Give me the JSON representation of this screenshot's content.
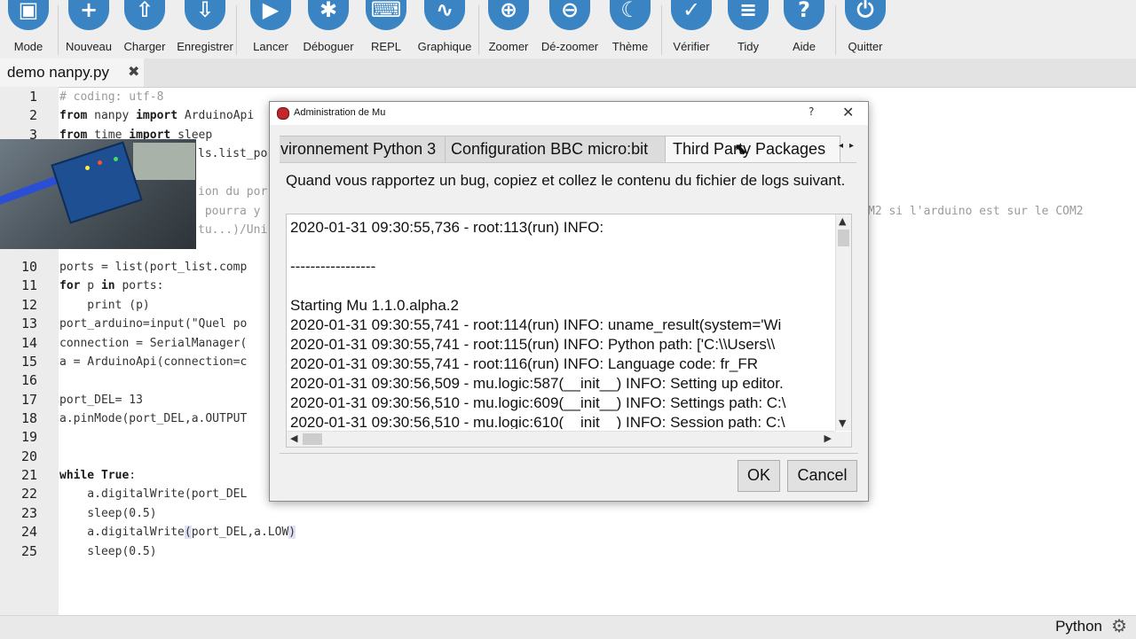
{
  "toolbar": {
    "buttons": [
      {
        "label": "Mode",
        "icon": "mode-icon",
        "glyph": "▣"
      },
      {
        "label": "Nouveau",
        "icon": "plus-icon",
        "glyph": "+"
      },
      {
        "label": "Charger",
        "icon": "upload-icon",
        "glyph": "⇧"
      },
      {
        "label": "Enregistrer",
        "icon": "download-icon",
        "glyph": "⇩"
      },
      {
        "label": "Lancer",
        "icon": "play-icon",
        "glyph": "▶"
      },
      {
        "label": "Déboguer",
        "icon": "bug-icon",
        "glyph": "✱"
      },
      {
        "label": "REPL",
        "icon": "keyboard-icon",
        "glyph": "⌨"
      },
      {
        "label": "Graphique",
        "icon": "pulse-icon",
        "glyph": "∿"
      },
      {
        "label": "Zoomer",
        "icon": "zoom-in-icon",
        "glyph": "⊕"
      },
      {
        "label": "Dé-zoomer",
        "icon": "zoom-out-icon",
        "glyph": "⊖"
      },
      {
        "label": "Thème",
        "icon": "moon-icon",
        "glyph": "☾"
      },
      {
        "label": "Vérifier",
        "icon": "thumbs-up-icon",
        "glyph": "✓"
      },
      {
        "label": "Tidy",
        "icon": "lines-icon",
        "glyph": "≡"
      },
      {
        "label": "Aide",
        "icon": "help-icon",
        "glyph": "?"
      },
      {
        "label": "Quitter",
        "icon": "power-icon",
        "glyph": "⏻"
      }
    ],
    "accent": "#3b84c4"
  },
  "editor": {
    "tab_name": "demo nanpy.py",
    "tab_close": "✖",
    "line_numbers": [
      "1",
      "2",
      "3",
      "10",
      "11",
      "12",
      "13",
      "14",
      "15",
      "16",
      "17",
      "18",
      "19",
      "20",
      "21",
      "22",
      "23",
      "24",
      "25"
    ],
    "lines": {
      "l1": "# coding: utf-8",
      "l2_kw1": "from",
      "l2_mid": " nanpy ",
      "l2_kw2": "import",
      "l2_rest": " ArduinoApi",
      "l3_kw1": "from",
      "l3_mid": " time ",
      "l3_kw2": "import",
      "l3_rest": " sleep",
      "l4": "ls.list_po",
      "l5": "ion du por",
      "l6": " pourra y ",
      "l7": "tu...)/Uni",
      "l10": "ports = list(port_list.comp",
      "l11_kw1": "for",
      "l11_mid": " p ",
      "l11_kw2": "in",
      "l11_rest": " ports:",
      "l12": "    print (p)",
      "l13": "port_arduino=input(\"Quel po",
      "l14": "connection = SerialManager(",
      "l15": "a = ArduinoApi(connection=c",
      "l17": "port_DEL= 13",
      "l18": "a.pinMode(port_DEL,a.OUTPUT",
      "l21_kw1": "while",
      "l21_sp": " ",
      "l21_kw2": "True",
      "l21_rest": ":",
      "l22": "    a.digitalWrite(port_DEL",
      "l23": "    sleep(0.5)",
      "l24_a": "    a.digitalWrite",
      "l24_p1": "(",
      "l24_b": "port_DEL,a.LOW",
      "l24_p2": ")",
      "l25": "    sleep(0.5)",
      "right_comment": "M2 si l'arduino est sur le COM2"
    }
  },
  "status": {
    "mode": "Python",
    "gear_icon": "⚙"
  },
  "dialog": {
    "title": "Administration de Mu",
    "help": "?",
    "close": "✕",
    "tabs": [
      "vironnement Python 3",
      "Configuration BBC micro:bit",
      "Third Party Packages"
    ],
    "tab_left_arrow": "◂",
    "tab_right_arrow": "▸",
    "label": "Quand vous rapportez un bug, copiez et collez le contenu du fichier de logs suivant.",
    "log_lines": [
      "2020-01-31 09:30:55,736 - root:113(run) INFO:",
      "",
      "-----------------",
      "",
      "Starting Mu 1.1.0.alpha.2",
      "2020-01-31 09:30:55,741 - root:114(run) INFO: uname_result(system='Wi",
      "2020-01-31 09:30:55,741 - root:115(run) INFO: Python path: ['C:\\\\Users\\\\",
      "2020-01-31 09:30:55,741 - root:116(run) INFO: Language code: fr_FR",
      "2020-01-31 09:30:56,509 - mu.logic:587(__init__) INFO: Setting up editor.",
      "2020-01-31 09:30:56,510 - mu.logic:609(__init__) INFO: Settings path: C:\\",
      "2020-01-31 09:30:56,510 - mu.logic:610(__init__) INFO: Session path: C:\\"
    ],
    "scroll": {
      "up": "▲",
      "down": "▼",
      "left": "◀",
      "right": "▶"
    },
    "ok": "OK",
    "cancel": "Cancel"
  }
}
